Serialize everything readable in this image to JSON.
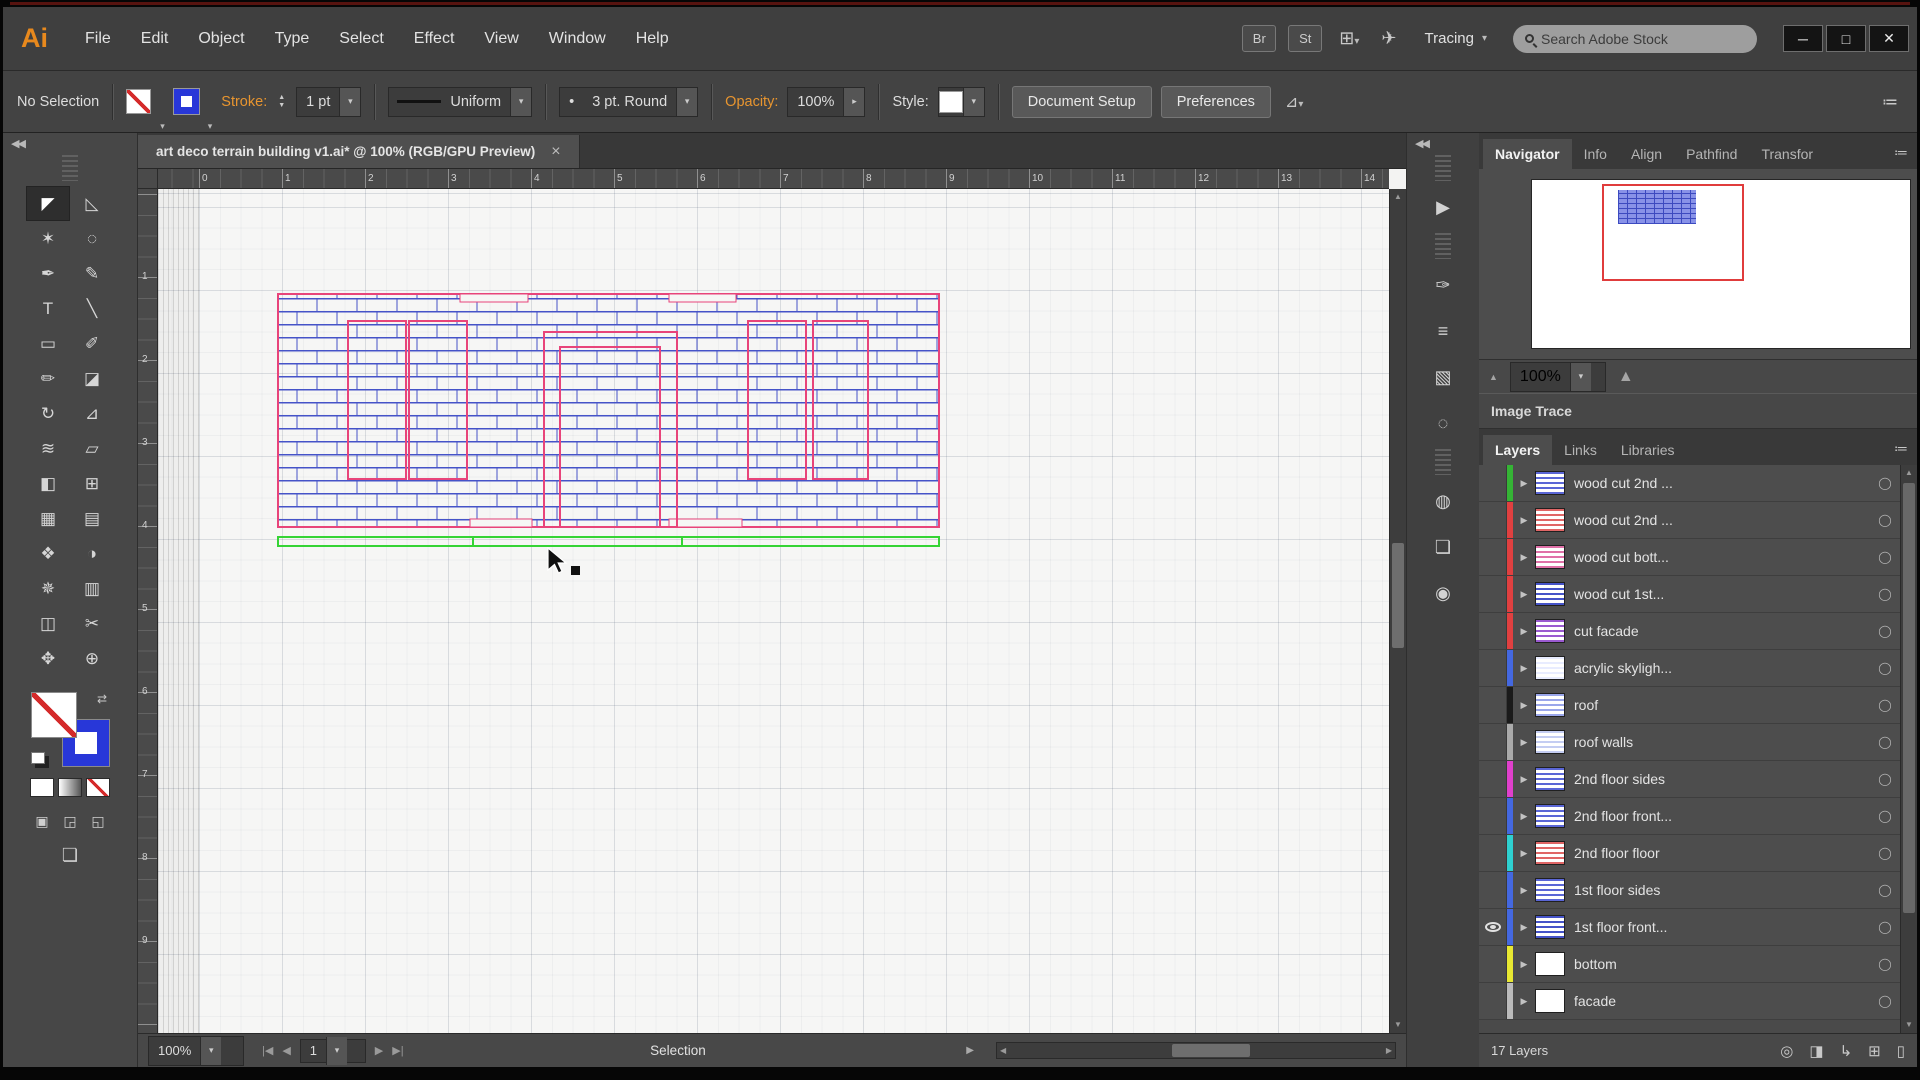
{
  "titlebar": {
    "minimize": "─",
    "maximize": "□",
    "close": "✕"
  },
  "menubar": {
    "logo": "Ai",
    "items": [
      "File",
      "Edit",
      "Object",
      "Type",
      "Select",
      "Effect",
      "View",
      "Window",
      "Help"
    ],
    "br": "Br",
    "st": "St",
    "tracing": "Tracing",
    "search_placeholder": "Search Adobe Stock"
  },
  "controlbar": {
    "no_selection": "No Selection",
    "stroke_label": "Stroke:",
    "stroke_weight": "1 pt",
    "width_profile": "Uniform",
    "brush_dot": "•",
    "brush": "3 pt. Round",
    "opacity_label": "Opacity:",
    "opacity_value": "100%",
    "style_label": "Style:",
    "document_setup": "Document Setup",
    "preferences": "Preferences"
  },
  "document_tab": {
    "title": "art deco terrain building v1.ai* @ 100% (RGB/GPU Preview)",
    "close": "×"
  },
  "rulers": {
    "top": [
      "0",
      "1",
      "2",
      "3",
      "4",
      "5",
      "6",
      "7",
      "8",
      "9",
      "10",
      "11",
      "12",
      "13",
      "14"
    ],
    "left": [
      "1",
      "2",
      "3",
      "4",
      "5",
      "6",
      "7",
      "8",
      "9"
    ]
  },
  "tools": [
    {
      "name": "selection",
      "glyph": "◤",
      "active": true
    },
    {
      "name": "direct-selection",
      "glyph": "◺",
      "active": false
    },
    {
      "name": "magic-wand",
      "glyph": "✶",
      "active": false
    },
    {
      "name": "lasso",
      "glyph": "◌",
      "active": false
    },
    {
      "name": "pen",
      "glyph": "✒",
      "active": false
    },
    {
      "name": "curvature",
      "glyph": "✎",
      "active": false
    },
    {
      "name": "type",
      "glyph": "T",
      "active": false
    },
    {
      "name": "line-segment",
      "glyph": "╲",
      "active": false
    },
    {
      "name": "rectangle",
      "glyph": "▭",
      "active": false
    },
    {
      "name": "paintbrush",
      "glyph": "✐",
      "active": false
    },
    {
      "name": "pencil",
      "glyph": "✏",
      "active": false
    },
    {
      "name": "eraser",
      "glyph": "◪",
      "active": false
    },
    {
      "name": "rotate",
      "glyph": "↻",
      "active": false
    },
    {
      "name": "scale",
      "glyph": "⊿",
      "active": false
    },
    {
      "name": "width",
      "glyph": "≋",
      "active": false
    },
    {
      "name": "free-transform",
      "glyph": "▱",
      "active": false
    },
    {
      "name": "shape-builder",
      "glyph": "◧",
      "active": false
    },
    {
      "name": "perspective-grid",
      "glyph": "⊞",
      "active": false
    },
    {
      "name": "mesh",
      "glyph": "▦",
      "active": false
    },
    {
      "name": "gradient",
      "glyph": "▤",
      "active": false
    },
    {
      "name": "eyedropper",
      "glyph": "❖",
      "active": false
    },
    {
      "name": "blend",
      "glyph": "◑",
      "active": false
    },
    {
      "name": "symbol-sprayer",
      "glyph": "✵",
      "active": false
    },
    {
      "name": "column-graph",
      "glyph": "▥",
      "active": false
    },
    {
      "name": "artboard",
      "glyph": "◫",
      "active": false
    },
    {
      "name": "slice",
      "glyph": "✂",
      "active": false
    },
    {
      "name": "hand",
      "glyph": "✥",
      "active": false
    },
    {
      "name": "zoom",
      "glyph": "⊕",
      "active": false
    }
  ],
  "toolbar_extras": {
    "swap": "⇄",
    "modes": [
      "▣",
      "◲",
      "◱"
    ],
    "screen_mode": "❏"
  },
  "dock_icons": [
    {
      "name": "actions-play-icon",
      "glyph": "▶"
    },
    {
      "name": "brushes-icon",
      "glyph": "✑"
    },
    {
      "name": "stroke-panel-icon",
      "glyph": "≡"
    },
    {
      "name": "swatches-icon",
      "glyph": "▧"
    },
    {
      "name": "transparency-icon",
      "glyph": "◌"
    },
    {
      "name": "appearance-icon",
      "glyph": "◍"
    },
    {
      "name": "graphic-styles-icon",
      "glyph": "❏"
    },
    {
      "name": "symbols-icon",
      "glyph": "◉"
    }
  ],
  "navigator": {
    "tabs": [
      "Navigator",
      "Info",
      "Align",
      "Pathfind",
      "Transfor"
    ],
    "zoom": "100%"
  },
  "image_trace": {
    "title": "Image Trace"
  },
  "layers_panel": {
    "tabs": [
      "Layers",
      "Links",
      "Libraries"
    ],
    "layers": [
      {
        "name": "wood cut 2nd ...",
        "color": "#35b435",
        "thumb": "#5a66d6",
        "visible": false
      },
      {
        "name": "wood cut 2nd ...",
        "color": "#e04040",
        "thumb": "#e06666",
        "visible": false
      },
      {
        "name": "wood cut bott...",
        "color": "#e04040",
        "thumb": "#e070a8",
        "visible": false
      },
      {
        "name": "wood cut 1st...",
        "color": "#e04040",
        "thumb": "#4553c8",
        "visible": false
      },
      {
        "name": "cut facade",
        "color": "#e04040",
        "thumb": "#9a5ad0",
        "visible": false
      },
      {
        "name": "acrylic skyligh...",
        "color": "#4468e0",
        "thumb": "#e8ecff",
        "visible": false
      },
      {
        "name": "roof",
        "color": "#1a1a1a",
        "thumb": "#9aa6ea",
        "visible": false
      },
      {
        "name": "roof walls",
        "color": "#aaaaaa",
        "thumb": "#c4cdf2",
        "visible": false
      },
      {
        "name": "2nd floor sides",
        "color": "#e040cc",
        "thumb": "#5a66d6",
        "visible": false
      },
      {
        "name": "2nd floor front...",
        "color": "#4468e0",
        "thumb": "#5a66d6",
        "visible": false
      },
      {
        "name": "2nd floor floor",
        "color": "#2ed0d0",
        "thumb": "#e06666",
        "visible": false
      },
      {
        "name": "1st floor sides",
        "color": "#4468e0",
        "thumb": "#5a66d6",
        "visible": false
      },
      {
        "name": "1st floor front...",
        "color": "#4468e0",
        "thumb": "#4553c8",
        "visible": true
      },
      {
        "name": "bottom",
        "color": "#e8e832",
        "thumb": "#ffffff",
        "visible": false
      },
      {
        "name": "facade",
        "color": "#bbbbbb",
        "thumb": "#ffffff",
        "visible": false
      }
    ],
    "footer_count": "17 Layers",
    "footer_icons": [
      {
        "name": "locate-object-icon",
        "glyph": "◎"
      },
      {
        "name": "clipping-mask-icon",
        "glyph": "◨"
      },
      {
        "name": "new-sublayer-icon",
        "glyph": "↳"
      },
      {
        "name": "new-layer-icon",
        "glyph": "⊞"
      },
      {
        "name": "trash-icon",
        "glyph": "▯"
      }
    ]
  },
  "statusbar": {
    "zoom": "100%",
    "first": "|◀",
    "prev": "◀",
    "artboard": "1",
    "next": "▶",
    "last": "▶|",
    "label": "Selection"
  },
  "colors": {
    "brick_blue": "#4553c8",
    "outline_red": "#e8447a",
    "baseline_green": "#35d435",
    "view_red": "#e03c3c",
    "accent_orange": "#e8952f"
  }
}
